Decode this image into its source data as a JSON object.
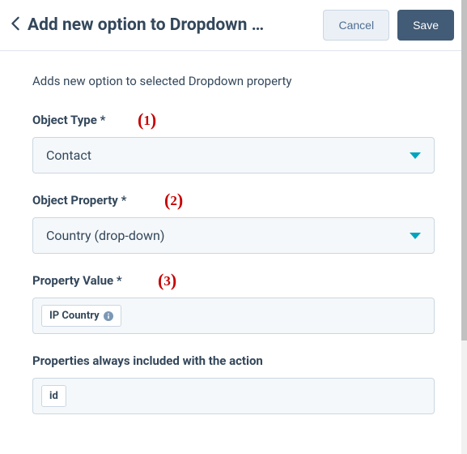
{
  "header": {
    "title": "Add new option to Dropdown …",
    "cancel_label": "Cancel",
    "save_label": "Save"
  },
  "description": "Adds new option to selected Dropdown property",
  "annotations": {
    "a1": "1",
    "a2": "2",
    "a3": "3"
  },
  "fields": {
    "object_type": {
      "label": "Object Type",
      "required_mark": "*",
      "value": "Contact"
    },
    "object_property": {
      "label": "Object Property",
      "required_mark": "*",
      "value": "Country (drop-down)"
    },
    "property_value": {
      "label": "Property Value",
      "required_mark": "*",
      "tag": "IP Country"
    },
    "always_included": {
      "label": "Properties always included with the action",
      "tag": "id"
    }
  }
}
